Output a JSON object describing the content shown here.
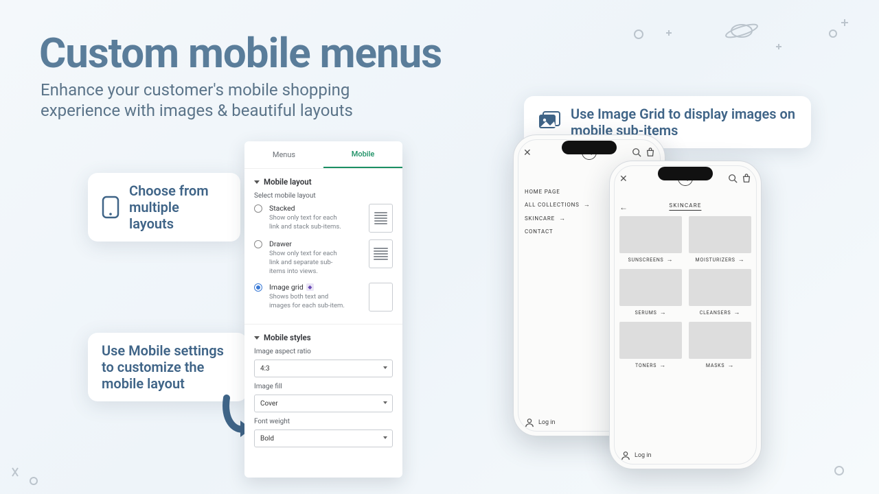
{
  "hero": {
    "title": "Custom mobile menus",
    "subtitle": "Enhance your customer's mobile shopping experience with images & beautiful layouts"
  },
  "callouts": {
    "layouts": "Choose from multiple layouts",
    "settings": "Use Mobile settings to customize the mobile layout",
    "grid": "Use Image Grid to display images on mobile sub-items"
  },
  "panel": {
    "tabs": {
      "menus": "Menus",
      "mobile": "Mobile"
    },
    "section_layout": "Mobile layout",
    "select_label": "Select mobile layout",
    "options": {
      "stacked": {
        "title": "Stacked",
        "desc": "Show only text for each link and stack sub-items."
      },
      "drawer": {
        "title": "Drawer",
        "desc": "Show only text for each link and separate sub-items into views."
      },
      "grid": {
        "title": "Image grid",
        "desc": "Shows both text and images for each sub-item."
      }
    },
    "section_styles": "Mobile styles",
    "aspect_label": "Image aspect ratio",
    "aspect_value": "4:3",
    "fill_label": "Image fill",
    "fill_value": "Cover",
    "weight_label": "Font weight",
    "weight_value": "Bold"
  },
  "phone1": {
    "nav": [
      "HOME PAGE",
      "ALL COLLECTIONS",
      "SKINCARE",
      "CONTACT"
    ],
    "login": "Log in"
  },
  "phone2": {
    "category": "SKINCARE",
    "items": [
      "SUNSCREENS",
      "MOISTURIZERS",
      "SERUMS",
      "CLEANSERS",
      "TONERS",
      "MASKS"
    ],
    "login": "Log in"
  }
}
